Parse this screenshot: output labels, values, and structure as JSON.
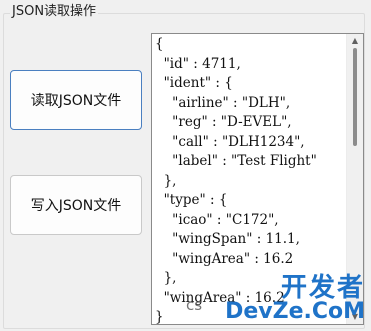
{
  "groupbox": {
    "title": "JSON读取操作"
  },
  "buttons": {
    "read_label": "读取JSON文件",
    "write_label": "写入JSON文件"
  },
  "textedit": {
    "content": "{\n  \"id\" : 4711,\n  \"ident\" : {\n    \"airline\" : \"DLH\",\n    \"reg\" : \"D-EVEL\",\n    \"call\" : \"DLH1234\",\n    \"label\" : \"Test Flight\"\n  },\n  \"type\" : {\n    \"icao\" : \"C172\",\n    \"wingSpan\" : 11.1,\n    \"wingArea\" : 16.2\n  },\n  \"wingArea\" : 16.2\n}"
  },
  "watermark": {
    "prefix": "cs",
    "line1": "开发者",
    "line2": "DevZe.CoM"
  }
}
